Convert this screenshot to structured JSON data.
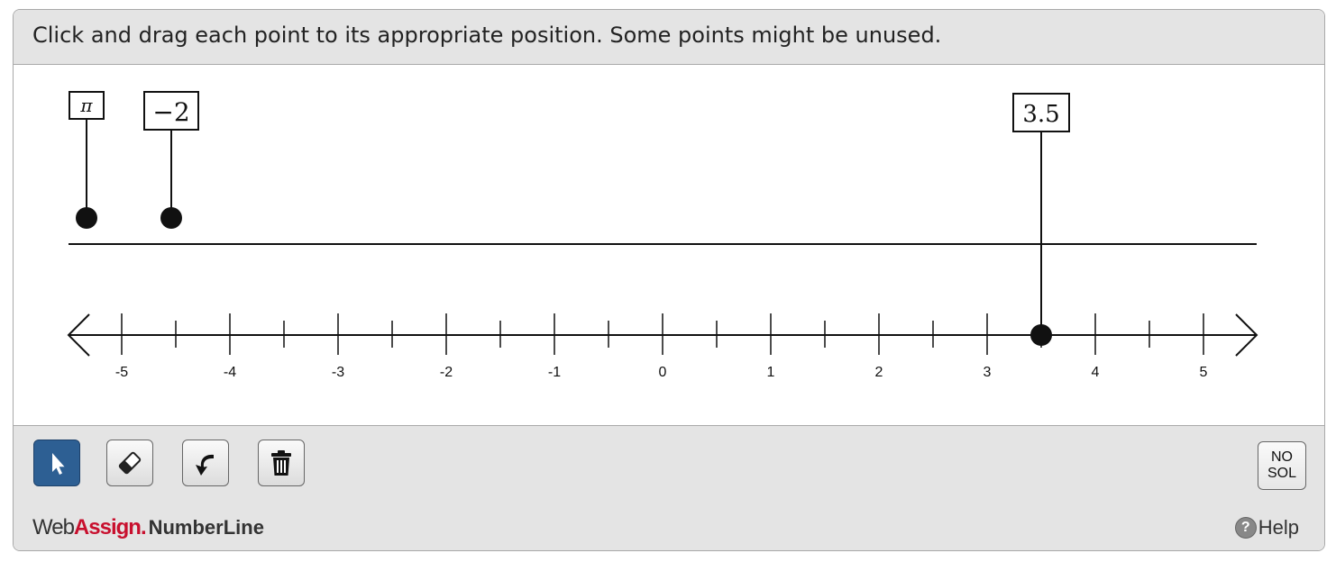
{
  "header": {
    "instructions": "Click and drag each point to its appropriate position. Some points might be unused."
  },
  "number_line": {
    "ticks": [
      "-5",
      "-4",
      "-3",
      "-2",
      "-1",
      "0",
      "1",
      "2",
      "3",
      "4",
      "5"
    ],
    "range": [
      -5.5,
      5.5
    ],
    "minor_step": 0.5,
    "placed_points": [
      {
        "label": "3.5",
        "value": 3.5
      }
    ],
    "unused_points": [
      {
        "label": "π"
      },
      {
        "label": "−2"
      }
    ]
  },
  "toolbar": {
    "tools": [
      {
        "name": "select-tool",
        "icon": "pointer-arrow-icon",
        "active": true
      },
      {
        "name": "eraser-tool",
        "icon": "eraser-icon",
        "active": false
      },
      {
        "name": "undo-tool",
        "icon": "undo-arrow-icon",
        "active": false
      },
      {
        "name": "delete-all-tool",
        "icon": "trash-icon",
        "active": false
      }
    ],
    "nosol_line1": "NO",
    "nosol_line2": "SOL"
  },
  "footer": {
    "brand_web": "Web",
    "brand_assign": "Assign",
    "brand_dot": ".",
    "product": "NumberLine",
    "help_label": "Help",
    "help_icon": "help-circle-icon"
  },
  "colors": {
    "panel_bg": "#e4e4e4",
    "active_tool": "#2d5f93",
    "brand_red": "#c8102e"
  }
}
